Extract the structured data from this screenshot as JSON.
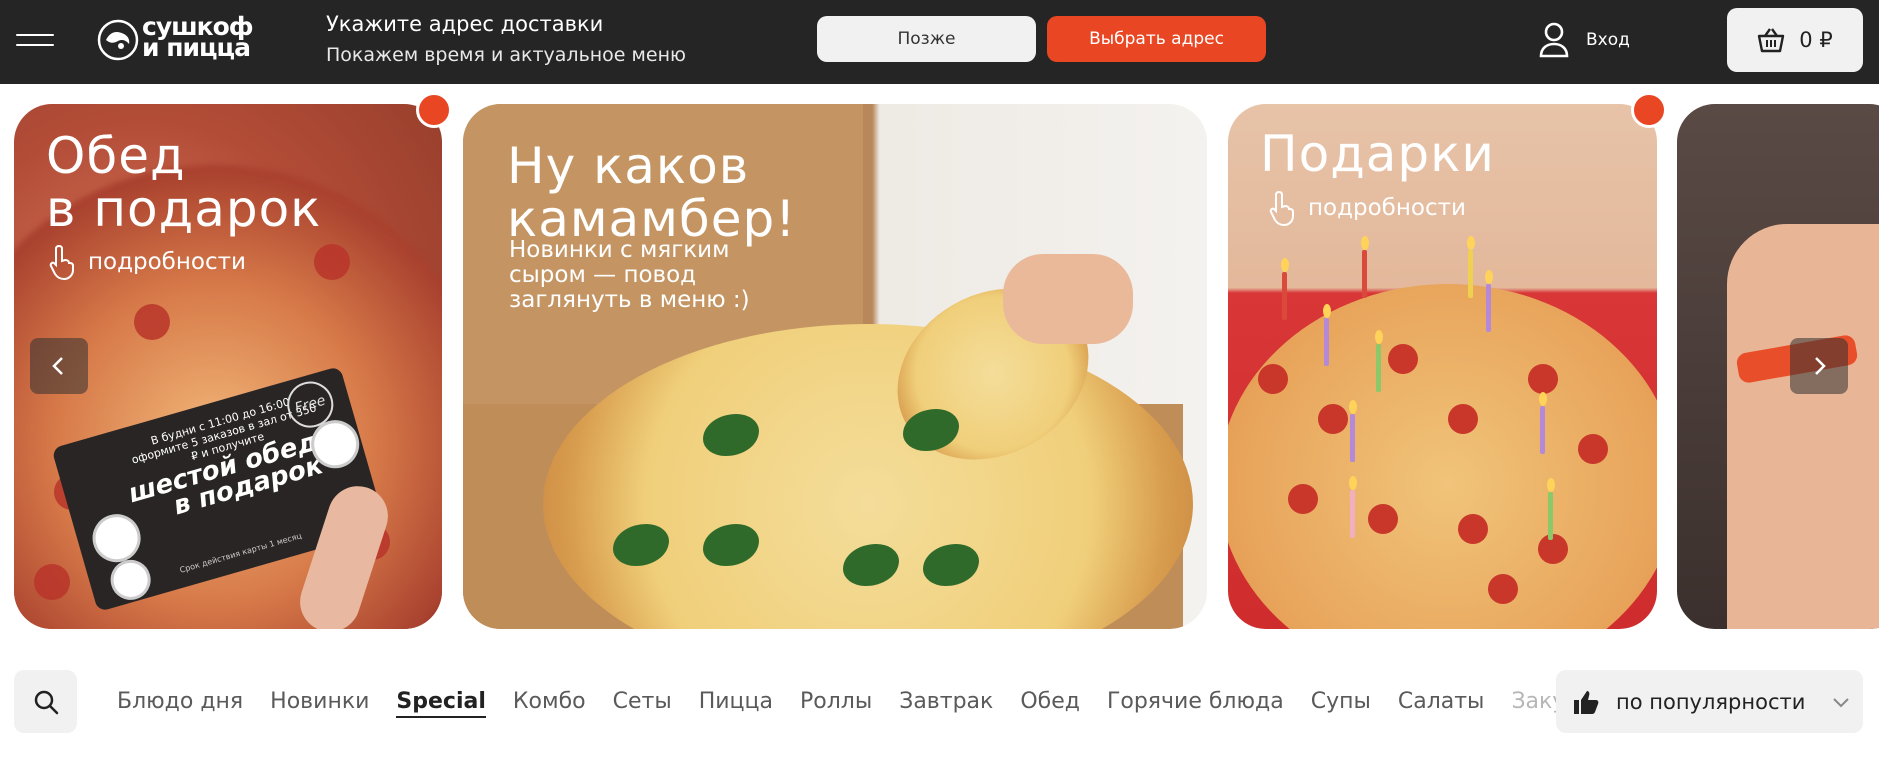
{
  "header": {
    "logo_text_line1": "сушкоф",
    "logo_text_line2": "и пицца",
    "address_title": "Укажите адрес доставки",
    "address_subtitle": "Покажем время и актуальное меню",
    "later_label": "Позже",
    "choose_label": "Выбрать адрес",
    "login_label": "Вход",
    "cart_total": "0 ₽"
  },
  "banners": [
    {
      "title_line1": "Обед",
      "title_line2": "в подарок",
      "more": "подробности",
      "card": {
        "text": "В будни с 11:00 до 16:00 оформите 5 заказов в зал от 350 ₽ и получите",
        "big1": "шестой обед",
        "big2": "в подарок",
        "free": "Free",
        "footer": "Срок действия карты 1 месяц"
      }
    },
    {
      "title_line1": "Ну каков",
      "title_line2": "камамбер!",
      "desc_line1": "Новинки с мягким",
      "desc_line2": "сыром — повод",
      "desc_line3": "заглянуть в меню :)"
    },
    {
      "title_line1": "Подарки",
      "more": "подробности"
    }
  ],
  "categories": [
    "Блюдо дня",
    "Новинки",
    "Special",
    "Комбо",
    "Сеты",
    "Пицца",
    "Роллы",
    "Завтрак",
    "Обед",
    "Горячие блюда",
    "Супы",
    "Салаты",
    "Закуски"
  ],
  "active_category": "Special",
  "sort_label": "по популярности",
  "colors": {
    "accent": "#e94624",
    "header_bg": "#252525"
  }
}
